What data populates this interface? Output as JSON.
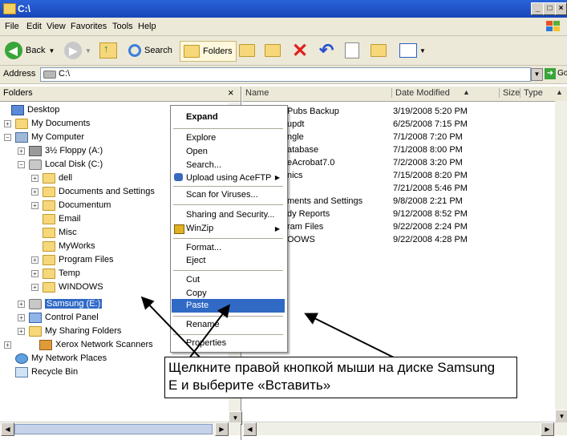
{
  "window": {
    "title": "C:\\"
  },
  "menu": [
    "File",
    "Edit",
    "View",
    "Favorites",
    "Tools",
    "Help"
  ],
  "toolbar": {
    "back": "Back",
    "search": "Search",
    "folders": "Folders"
  },
  "address": {
    "label": "Address",
    "value": "C:\\",
    "go": "Go"
  },
  "folders_pane": {
    "title": "Folders",
    "close": "×"
  },
  "tree": [
    {
      "label": "Desktop"
    },
    {
      "label": "My Documents"
    },
    {
      "label": "My Computer"
    },
    {
      "label": "3½ Floppy (A:)"
    },
    {
      "label": "Local Disk (C:)"
    },
    {
      "label": "dell"
    },
    {
      "label": "Documents and Settings"
    },
    {
      "label": "Documentum"
    },
    {
      "label": "Email"
    },
    {
      "label": "Misc"
    },
    {
      "label": "MyWorks"
    },
    {
      "label": "Program Files"
    },
    {
      "label": "Temp"
    },
    {
      "label": "WINDOWS"
    },
    {
      "label": "Samsung (E:)"
    },
    {
      "label": "Control Panel"
    },
    {
      "label": "My Sharing Folders"
    },
    {
      "label": "Xerox Network Scanners"
    },
    {
      "label": "My Network Places"
    },
    {
      "label": "Recycle Bin"
    }
  ],
  "columns": {
    "name": "Name",
    "date": "Date Modified",
    "size": "Size",
    "type": "Type"
  },
  "files": [
    {
      "name": "Pubs Backup",
      "date": "3/19/2008 5:20 PM"
    },
    {
      "name": "updt",
      "date": "6/25/2008 7:15 PM"
    },
    {
      "name": "ngle",
      "date": "7/1/2008 7:20 PM"
    },
    {
      "name": "atabase",
      "date": "7/1/2008 8:00 PM"
    },
    {
      "name": "eAcrobat7.0",
      "date": "7/2/2008 3:20 PM"
    },
    {
      "name": "nics",
      "date": "7/15/2008 8:20 PM"
    },
    {
      "name": "",
      "date": "7/21/2008 5:46 PM"
    },
    {
      "name": "ments and Settings",
      "date": "9/8/2008 2:21 PM"
    },
    {
      "name": "dy Reports",
      "date": "9/12/2008 8:52 PM"
    },
    {
      "name": "ram Files",
      "date": "9/22/2008 2:24 PM"
    },
    {
      "name": "OOWS",
      "date": "9/22/2008 4:28 PM"
    }
  ],
  "context_menu": {
    "expand": "Expand",
    "explore": "Explore",
    "open": "Open",
    "search": "Search...",
    "upload": "Upload using AceFTP",
    "scan": "Scan for Viruses...",
    "sharing": "Sharing and Security...",
    "winzip": "WinZip",
    "format": "Format...",
    "eject": "Eject",
    "cut": "Cut",
    "copy": "Copy",
    "paste": "Paste",
    "rename": "Rename",
    "properties": "Properties"
  },
  "callout": {
    "line1": "Щелкните правой кнопкой мыши на диске Samsung",
    "line2": "E и выберите «Вставить»"
  },
  "colors": {
    "title_bar": "#1746b8",
    "menu_highlight": "#316ac5",
    "chrome": "#ece9d8"
  }
}
